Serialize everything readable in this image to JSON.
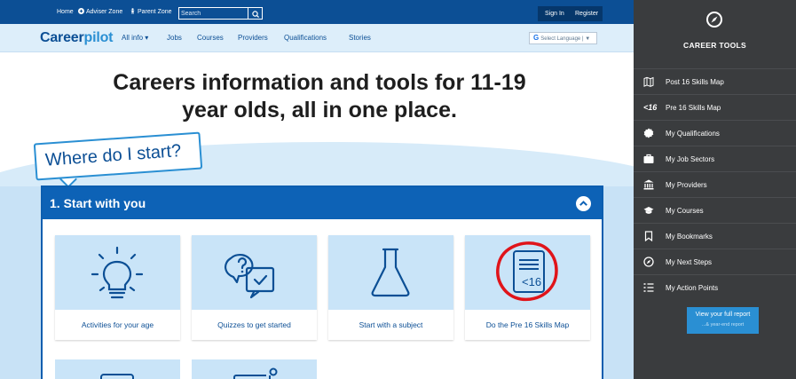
{
  "topbar": {
    "home": "Home",
    "adviser_zone": "Adviser Zone",
    "parent_zone": "Parent Zone",
    "search_placeholder": "Search",
    "sign_in": "Sign In",
    "register": "Register"
  },
  "nav": {
    "logo_career": "Career",
    "logo_pilot": "pilot",
    "items": [
      "All info ▾",
      "Jobs",
      "Courses",
      "Providers",
      "Qualifications",
      "Stories"
    ],
    "language_label": "Select Language",
    "language_caret": "▼"
  },
  "hero": {
    "title_line1": "Careers information and tools for 11-19",
    "title_line2": "year olds, all in one place.",
    "bubble": "Where do I start?"
  },
  "panel": {
    "title": "1. Start with you",
    "tiles": [
      {
        "label": "Activities for your age",
        "icon": "lightbulb-icon"
      },
      {
        "label": "Quizzes to get started",
        "icon": "quiz-icon"
      },
      {
        "label": "Start with a subject",
        "icon": "flask-icon"
      },
      {
        "label": "Do the Pre 16 Skills Map",
        "icon": "skills-map-icon",
        "badge": "<16"
      }
    ]
  },
  "sidebar": {
    "title": "CAREER TOOLS",
    "items": [
      {
        "label": "Post 16 Skills Map",
        "icon": "map-icon"
      },
      {
        "label": "Pre 16 Skills Map",
        "icon": "pre16-icon",
        "glyph": "<16"
      },
      {
        "label": "My Qualifications",
        "icon": "certificate-icon"
      },
      {
        "label": "My Job Sectors",
        "icon": "briefcase-icon"
      },
      {
        "label": "My Providers",
        "icon": "institution-icon"
      },
      {
        "label": "My Courses",
        "icon": "graduation-cap-icon"
      },
      {
        "label": "My Bookmarks",
        "icon": "bookmark-icon"
      },
      {
        "label": "My Next Steps",
        "icon": "compass-icon"
      },
      {
        "label": "My Action Points",
        "icon": "checklist-icon"
      }
    ],
    "report_button": "View your full report",
    "report_sub": "...& year-end report"
  },
  "colors": {
    "brand_dark": "#0c4f95",
    "brand_blue": "#0d62b6",
    "accent": "#2a8fd3",
    "sidebar_bg": "#3a3c3e",
    "annotation_red": "#e0141a"
  }
}
